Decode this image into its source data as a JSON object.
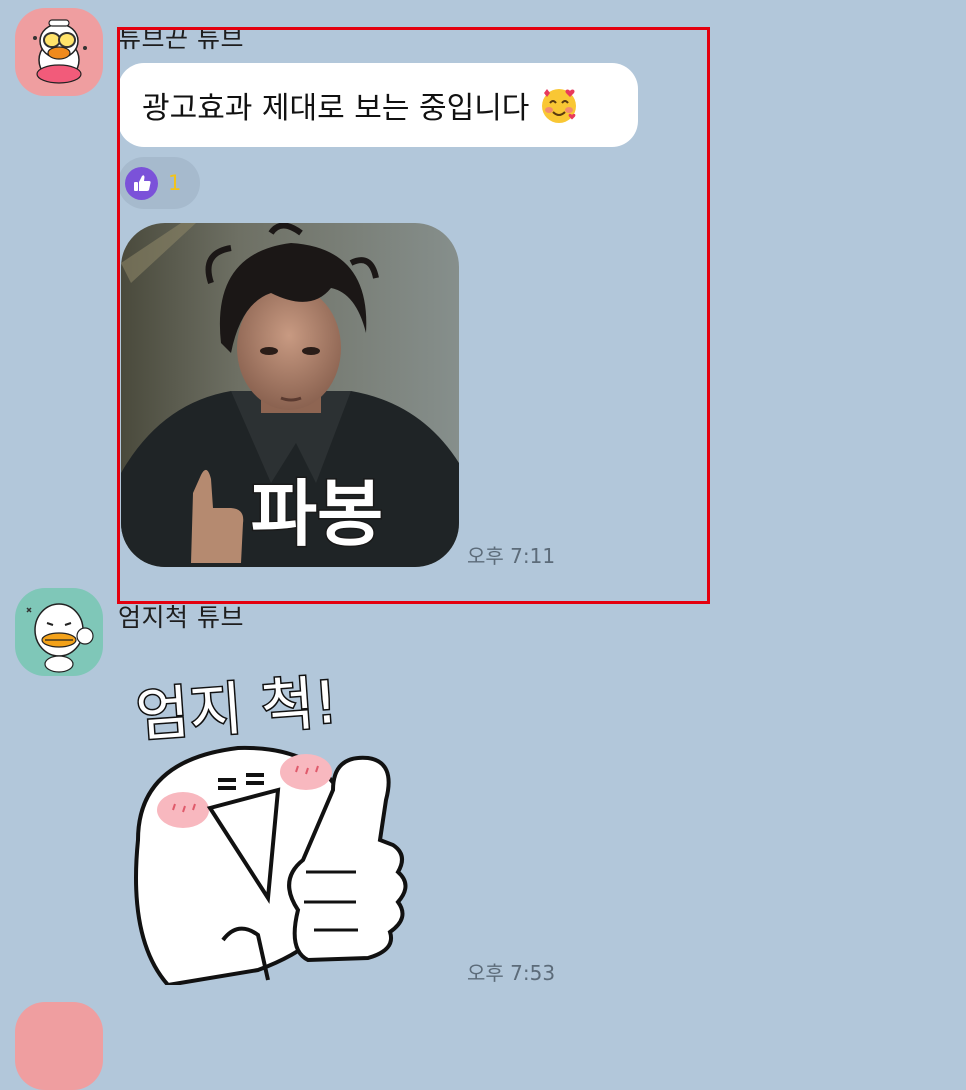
{
  "messages": [
    {
      "sender": "튜브끈 튜브",
      "text": "광고효과 제대로 보는 중입니다",
      "text_emoji": "smiling-face-with-hearts-icon",
      "reaction": {
        "icon": "thumbs-up-icon",
        "count": "1"
      },
      "image_caption": "파봉",
      "time": "오후 7:11"
    },
    {
      "sender": "엄지척 튜브",
      "sticker_text": "엄지 척!",
      "time": "오후 7:53"
    }
  ],
  "colors": {
    "background": "#b2c7da",
    "highlight": "#e4000f",
    "reaction_like": "#7b52d9",
    "reaction_count": "#f2c31b"
  }
}
